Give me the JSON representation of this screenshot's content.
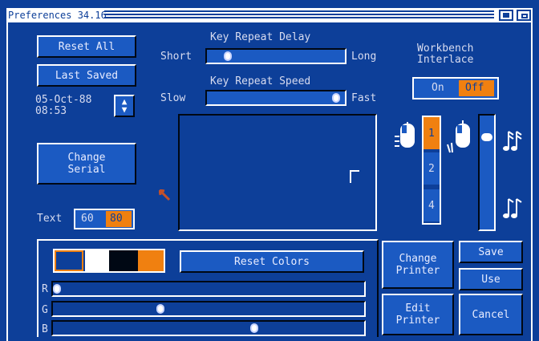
{
  "window": {
    "title": "Preferences 34.16"
  },
  "buttons": {
    "reset_all": "Reset All",
    "last_saved": "Last Saved",
    "change_serial": "Change\nSerial",
    "reset_colors": "Reset Colors",
    "change_printer": "Change\nPrinter",
    "edit_printer": "Edit\nPrinter",
    "save": "Save",
    "use": "Use",
    "cancel": "Cancel"
  },
  "clock": {
    "date": "05-Oct-88",
    "time": "08:53"
  },
  "key_repeat_delay": {
    "label": "Key Repeat Delay",
    "min_label": "Short",
    "max_label": "Long",
    "value": 0.13
  },
  "key_repeat_speed": {
    "label": "Key Repeat Speed",
    "min_label": "Slow",
    "max_label": "Fast",
    "value": 0.96
  },
  "workbench_interlace": {
    "label": "Workbench\nInterlace",
    "on": "On",
    "off": "Off",
    "selected": "Off"
  },
  "text_columns": {
    "label": "Text",
    "options": [
      "60",
      "80"
    ],
    "selected": "80"
  },
  "mouse_speed": {
    "options": [
      "1",
      "2",
      "4"
    ],
    "selected": "1"
  },
  "double_click": {
    "value": 0.17
  },
  "colors": {
    "palette": [
      "#0d3f99",
      "#ffffff",
      "#000814",
      "#f08010"
    ],
    "selected_index": 0,
    "sliders": [
      {
        "label": "R",
        "value": 0.0
      },
      {
        "label": "G",
        "value": 0.34
      },
      {
        "label": "B",
        "value": 0.65
      }
    ]
  },
  "theme": {
    "accent": "#f08010",
    "background": "#0d3f99",
    "button": "#1b5ac2",
    "text": "#d8dcf0"
  }
}
